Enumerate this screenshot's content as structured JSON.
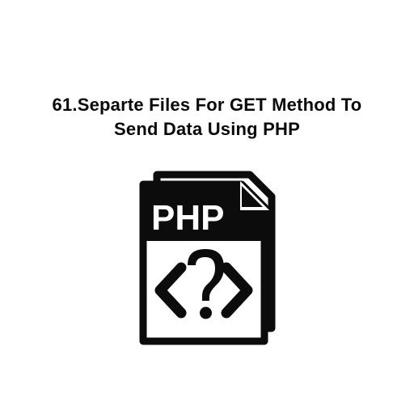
{
  "heading": {
    "line1": "61.Separte Files For GET Method To",
    "line2": "Send Data Using PHP"
  },
  "icon": {
    "label": "PHP"
  }
}
